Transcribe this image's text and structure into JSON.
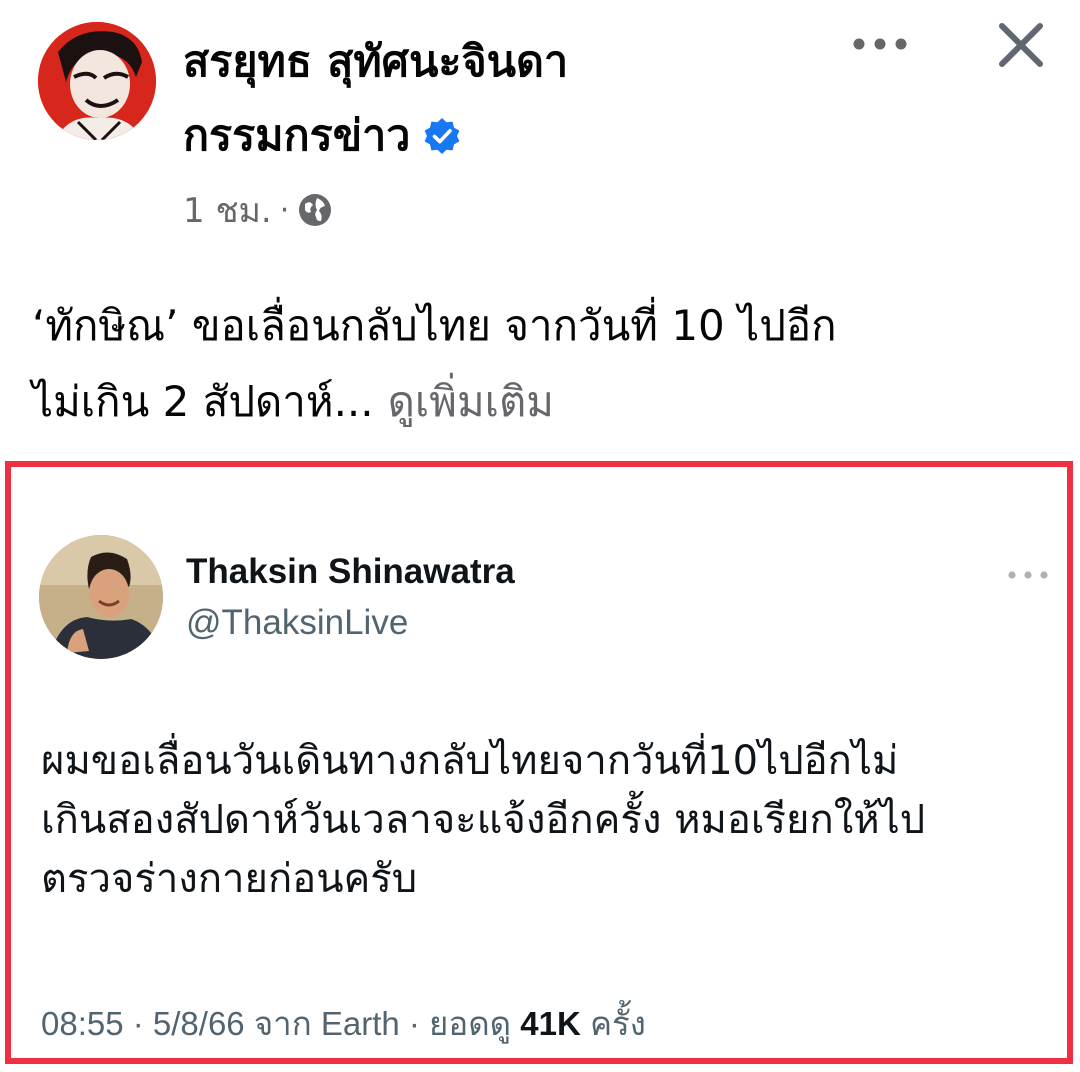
{
  "post": {
    "author": {
      "name_line1": "สรยุทธ สุทัศนะจินดา",
      "name_line2": "กรรมกรข่าว",
      "verified_icon": "verified-badge-icon"
    },
    "time": "1 ชม.",
    "separator": "·",
    "audience_icon": "globe-icon",
    "text_line1": "‘ทักษิณ’ ขอเลื่อนกลับไทย จากวันที่ 10 ไปอีก",
    "text_line2": "ไม่เกิน 2 สัปดาห์...",
    "see_more": "ดูเพิ่มเติม"
  },
  "header_actions": {
    "more_icon": "more-horizontal-icon",
    "close_icon": "close-icon"
  },
  "embedded_tweet": {
    "frame_color": "#ee2f44",
    "name": "Thaksin Shinawatra",
    "handle": "@ThaksinLive",
    "more_icon": "more-horizontal-icon",
    "text_lines": [
      "ผมขอเลื่อนวันเดินทางกลับไทยจากวันที่10ไปอีกไม่",
      "เกินสองสัปดาห์วันเวลาจะแจ้งอีกครั้ง หมอเรียกให้ไป",
      "ตรวจร่างกายก่อนครับ"
    ],
    "footer_prefix": "08:55 · 5/8/66 จาก Earth · ยอดดู",
    "views": "41K",
    "footer_suffix": "ครั้ง"
  },
  "colors": {
    "text_primary": "#050505",
    "text_secondary": "#65676b",
    "verified_blue": "#1877f2",
    "tweet_text": "#0f1419",
    "tweet_secondary": "#536471"
  }
}
